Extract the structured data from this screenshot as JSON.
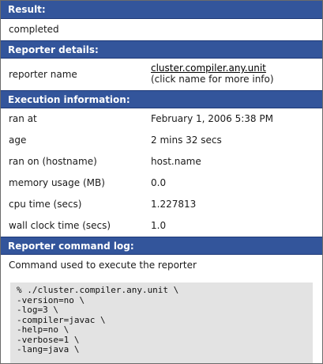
{
  "result": {
    "header": "Result:",
    "value": "completed"
  },
  "reporter_details": {
    "header": "Reporter details:",
    "name_label": "reporter name",
    "name_link": "cluster.compiler.any.unit",
    "name_hint": "(click name for more info)"
  },
  "execution": {
    "header": "Execution information:",
    "rows": [
      {
        "label": "ran at",
        "value": "February 1, 2006 5:38 PM"
      },
      {
        "label": "age",
        "value": "2 mins 32 secs"
      },
      {
        "label": "ran on (hostname)",
        "value": "host.name"
      },
      {
        "label": "memory usage (MB)",
        "value": "0.0"
      },
      {
        "label": "cpu time (secs)",
        "value": "1.227813"
      },
      {
        "label": "wall clock time (secs)",
        "value": "1.0"
      }
    ]
  },
  "command_log": {
    "header": "Reporter command log:",
    "description": "Command used to execute the reporter",
    "lines": [
      "% ./cluster.compiler.any.unit \\",
      "-version=no \\",
      "-log=3 \\",
      "-compiler=javac \\",
      "-help=no \\",
      "-verbose=1 \\",
      "-lang=java \\"
    ]
  },
  "colors": {
    "header_bg": "#33559b",
    "header_text": "#ffffff",
    "code_bg": "#e3e3e3"
  }
}
